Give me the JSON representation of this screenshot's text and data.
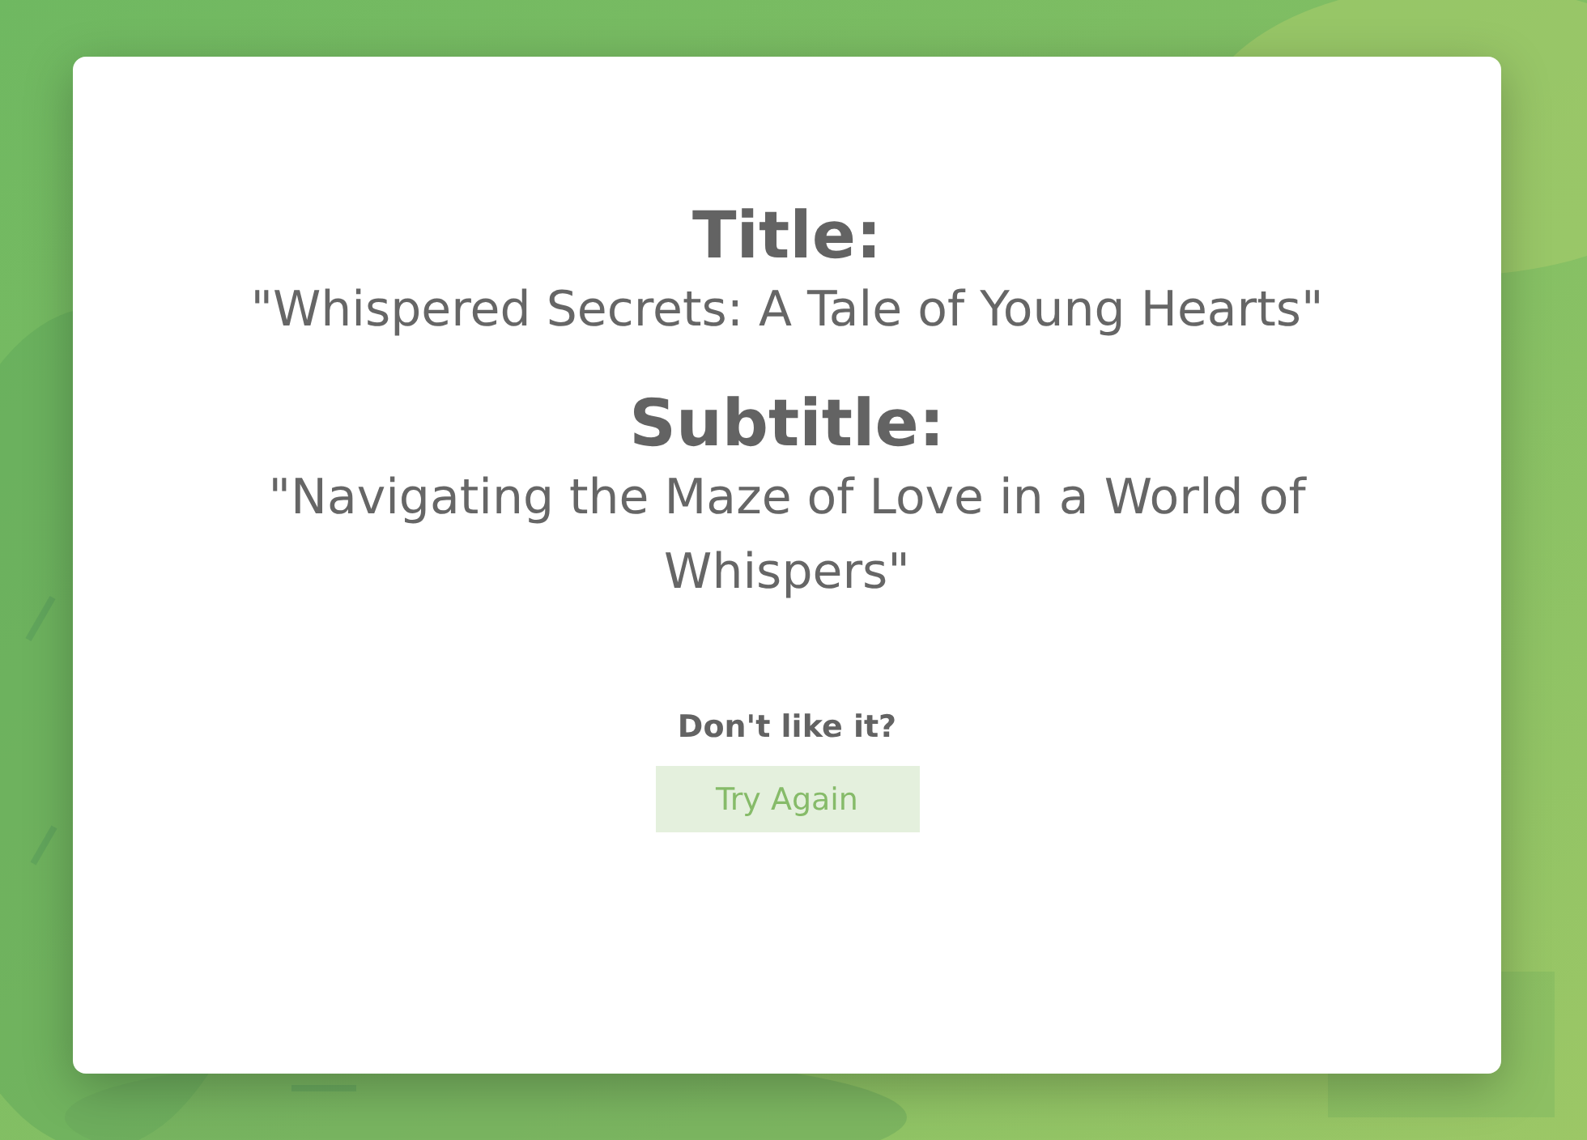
{
  "title_label": "Title:",
  "title": "\"Whispered Secrets: A Tale of Young Hearts\"",
  "subtitle_label": "Subtitle:",
  "subtitle": "\"Navigating the Maze of Love in a World of Whispers\"",
  "prompt": "Don't like it?",
  "button": "Try Again"
}
